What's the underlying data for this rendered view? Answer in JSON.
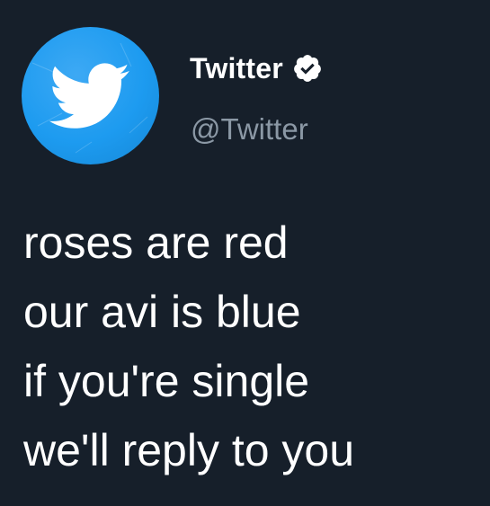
{
  "account": {
    "display_name": "Twitter",
    "handle": "@Twitter",
    "verified": true,
    "avatar_icon": "twitter-bird-icon",
    "avatar_color": "#1D9BF0"
  },
  "tweet": {
    "lines": [
      "roses are red",
      "our avi is blue",
      "if you're single",
      "we'll reply to you"
    ]
  },
  "theme": {
    "background": "#161F2A",
    "text": "#FFFFFF",
    "secondary_text": "#8B98A5"
  }
}
